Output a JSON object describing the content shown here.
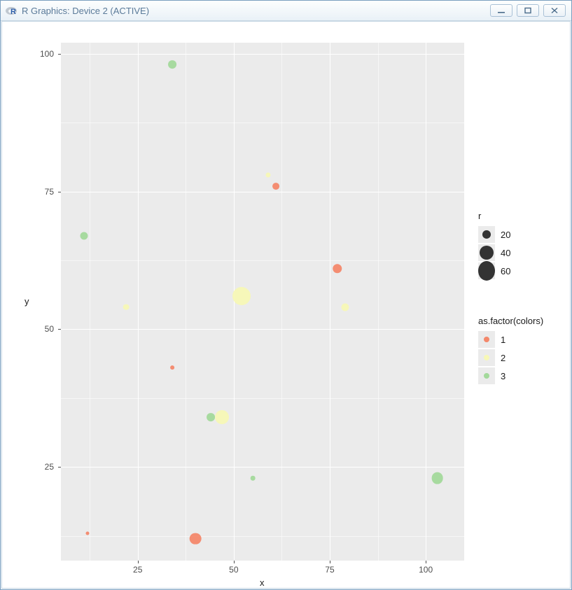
{
  "window": {
    "title": "R Graphics: Device 2 (ACTIVE)",
    "controls": {
      "minimize": "minimize",
      "maximize": "maximize",
      "close": "close"
    }
  },
  "chart_data": {
    "type": "scatter",
    "title": "",
    "xlabel": "x",
    "ylabel": "y",
    "xlim": [
      5,
      110
    ],
    "ylim": [
      8,
      102
    ],
    "x_ticks": [
      25,
      50,
      75,
      100
    ],
    "y_ticks": [
      25,
      50,
      75,
      100
    ],
    "size_variable": "r",
    "color_variable": "as.factor(colors)",
    "size_legend": [
      {
        "label": "20",
        "value": 20
      },
      {
        "label": "40",
        "value": 40
      },
      {
        "label": "60",
        "value": 60
      }
    ],
    "color_legend": [
      {
        "label": "1",
        "hex": "#f4886b"
      },
      {
        "label": "2",
        "hex": "#f7f8b6"
      },
      {
        "label": "3",
        "hex": "#a3d99b"
      }
    ],
    "points": [
      {
        "x": 34,
        "y": 98,
        "r": 20,
        "color": "3"
      },
      {
        "x": 59,
        "y": 78,
        "r": 8,
        "color": "2"
      },
      {
        "x": 61,
        "y": 76,
        "r": 15,
        "color": "1"
      },
      {
        "x": 11,
        "y": 67,
        "r": 18,
        "color": "3"
      },
      {
        "x": 77,
        "y": 61,
        "r": 24,
        "color": "1"
      },
      {
        "x": 52,
        "y": 56,
        "r": 55,
        "color": "2"
      },
      {
        "x": 22,
        "y": 54,
        "r": 12,
        "color": "2"
      },
      {
        "x": 79,
        "y": 54,
        "r": 18,
        "color": "2"
      },
      {
        "x": 34,
        "y": 43,
        "r": 5,
        "color": "1"
      },
      {
        "x": 44,
        "y": 34,
        "r": 20,
        "color": "3"
      },
      {
        "x": 47,
        "y": 34,
        "r": 40,
        "color": "2"
      },
      {
        "x": 55,
        "y": 23,
        "r": 7,
        "color": "3"
      },
      {
        "x": 103,
        "y": 23,
        "r": 32,
        "color": "3"
      },
      {
        "x": 12,
        "y": 13,
        "r": 3,
        "color": "1"
      },
      {
        "x": 40,
        "y": 12,
        "r": 32,
        "color": "1"
      }
    ]
  },
  "legend_titles": {
    "size": "r",
    "color": "as.factor(colors)"
  },
  "colors": {
    "panel_bg": "#ebebeb",
    "grid": "#ffffff",
    "text": "#4d4d4d"
  }
}
